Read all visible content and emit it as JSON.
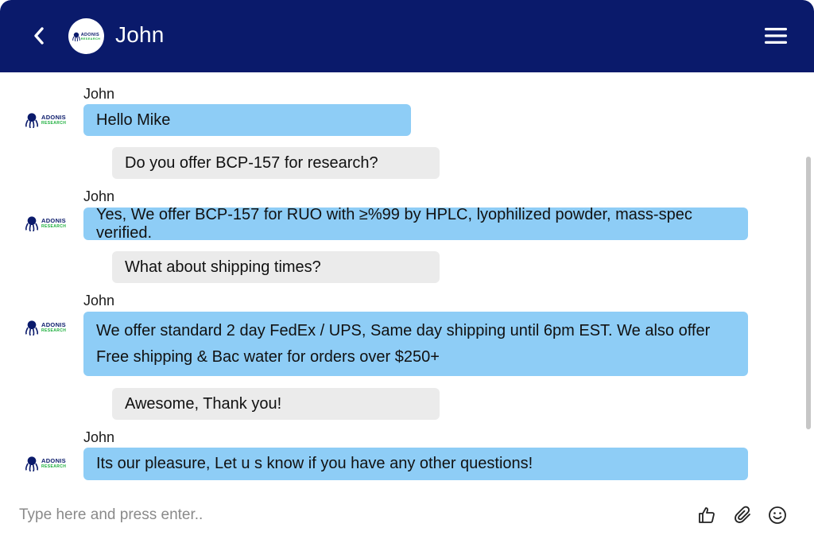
{
  "header": {
    "title": "John",
    "back_icon": "chevron-left-icon",
    "menu_icon": "hamburger-menu-icon",
    "logo": {
      "word": "ADONIS",
      "sub": "RESEARCH"
    }
  },
  "colors": {
    "header_bg": "#0a1a6b",
    "incoming_bubble": "#8ecdf6",
    "outgoing_bubble": "#ebebeb",
    "logo_green": "#1cae3c"
  },
  "messages": [
    {
      "direction": "incoming",
      "sender": "John",
      "lines": [
        "Hello Mike"
      ]
    },
    {
      "direction": "outgoing",
      "lines": [
        "Do you offer BCP-157 for research?"
      ]
    },
    {
      "direction": "incoming",
      "sender": "John",
      "lines": [
        "Yes, We offer BCP-157 for RUO with ≥%99 by HPLC, lyophilized powder, mass-spec verified."
      ]
    },
    {
      "direction": "outgoing",
      "lines": [
        "What about shipping times?"
      ]
    },
    {
      "direction": "incoming",
      "sender": "John",
      "lines": [
        "We offer standard 2 day FedEx / UPS, Same day shipping until 6pm EST. We also offer",
        "Free shipping & Bac water for orders over $250+"
      ]
    },
    {
      "direction": "outgoing",
      "lines": [
        "Awesome, Thank you!"
      ]
    },
    {
      "direction": "incoming",
      "sender": "John",
      "lines": [
        "Its our pleasure, Let u s know if you have any other questions!"
      ]
    }
  ],
  "composer": {
    "placeholder": "Type here and press enter..",
    "value": "",
    "icons": [
      "thumbs-up-icon",
      "paperclip-icon",
      "smiley-icon"
    ]
  }
}
